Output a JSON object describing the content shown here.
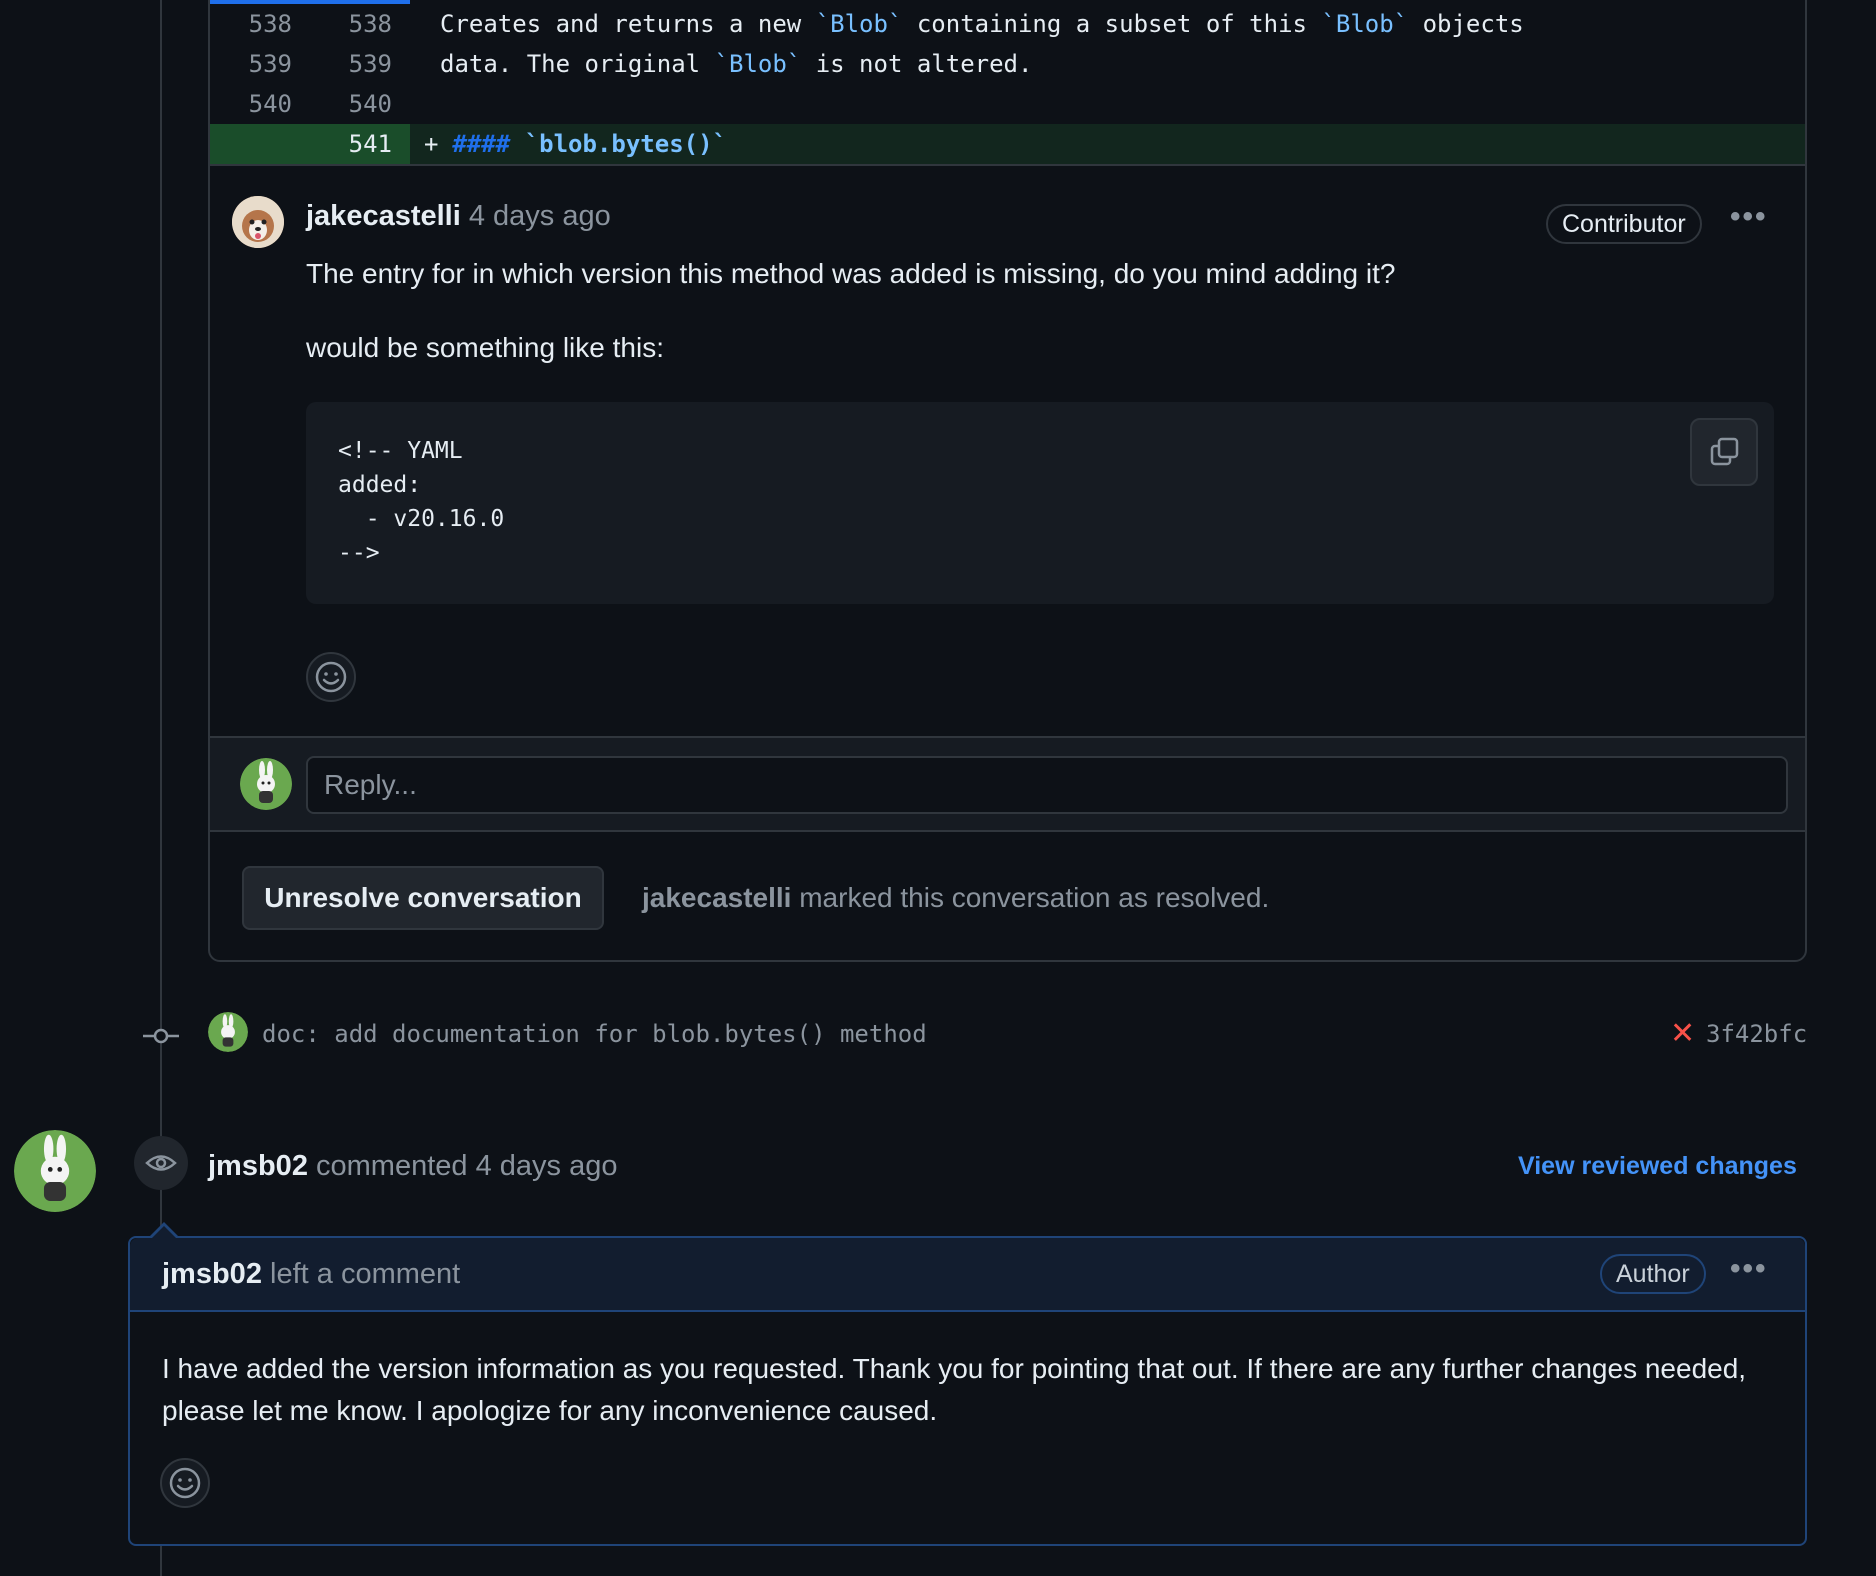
{
  "diff": {
    "lines": [
      {
        "old": "538",
        "new": "538",
        "parts": [
          "Creates and returns a new ",
          "`Blob`",
          " containing a subset of this ",
          "`Blob`",
          " objects"
        ]
      },
      {
        "old": "539",
        "new": "539",
        "parts": [
          "data. The original ",
          "`Blob`",
          " is not altered."
        ]
      },
      {
        "old": "540",
        "new": "540",
        "parts": [
          ""
        ]
      }
    ],
    "added": {
      "new": "541",
      "plus": "+",
      "hashes": "####",
      "code": "`blob.bytes()`"
    }
  },
  "comment1": {
    "author": "jakecastelli",
    "time": "4 days ago",
    "badge": "Contributor",
    "more": "•••",
    "text1": "The entry for in which version this method was added is missing, do you mind adding it?",
    "text2": "would be something like this:",
    "code": "<!-- YAML\nadded:\n  - v20.16.0\n-->"
  },
  "reply": {
    "placeholder": "Reply..."
  },
  "resolve": {
    "button": "Unresolve conversation",
    "user": "jakecastelli",
    "text": " marked this conversation as resolved."
  },
  "commit": {
    "message": "doc: add documentation for blob.bytes() method",
    "status_icon": "✕",
    "sha": "3f42bfc"
  },
  "review": {
    "author": "jmsb02",
    "action": " commented 4 days ago",
    "link": "View reviewed changes"
  },
  "comment2": {
    "author": "jmsb02",
    "action": " left a comment",
    "badge": "Author",
    "more": "•••",
    "text": "I have added the version information as you requested. Thank you for pointing that out. If there are any further changes needed, please let me know. I apologize for any inconvenience caused."
  }
}
